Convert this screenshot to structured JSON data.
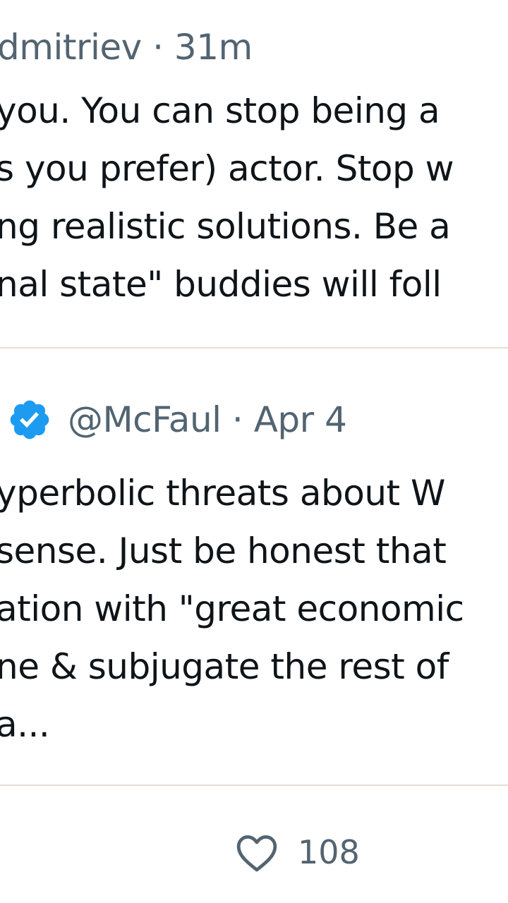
{
  "reply": {
    "author_time": "dmitriev · 31m",
    "lines": [
      "you. You can stop being a",
      "s you prefer) actor. Stop w",
      "ng realistic solutions. Be a",
      "nal state\" buddies will foll"
    ]
  },
  "quote": {
    "handle_date": "@McFaul · Apr 4",
    "lines": [
      "yperbolic threats about W",
      "sense. Just be honest that",
      "ation with \"great economic",
      "ne & subjugate the rest of",
      "a..."
    ]
  },
  "actions": {
    "like_count": "108"
  },
  "colors": {
    "verified_blue": "#1d9bf0",
    "muted_text": "#536471",
    "divider": "#e7ddd6"
  },
  "icons": {
    "verified": "verified-badge-icon",
    "like": "heart-icon"
  }
}
